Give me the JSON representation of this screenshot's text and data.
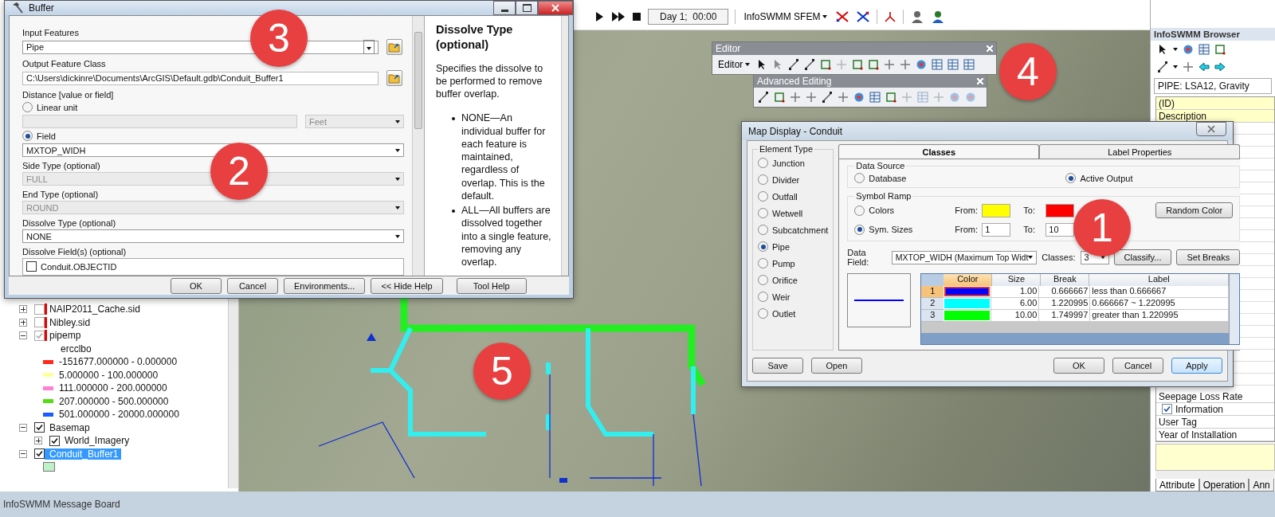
{
  "top_toolbar": {
    "time": "Day 1;  00:00",
    "menu": "InfoSWMM SFEM"
  },
  "editor_toolbar": {
    "title": "Editor",
    "menu": "Editor"
  },
  "advanced_editing_toolbar": {
    "title": "Advanced Editing"
  },
  "buffer_dialog": {
    "title": "Buffer",
    "fields": [
      {
        "kind": "input",
        "label": "Input Features",
        "value": "Pipe"
      },
      {
        "kind": "path",
        "label": "Output Feature Class",
        "value": "C:\\Users\\dickinre\\Documents\\ArcGIS\\Default.gdb\\Conduit_Buffer1"
      },
      {
        "kind": "heading",
        "label": "Distance [value or field]"
      },
      {
        "kind": "radio",
        "label": "Linear unit",
        "selected": false
      },
      {
        "kind": "unit",
        "unit": "Feet",
        "disabled": true
      },
      {
        "kind": "radio",
        "label": "Field",
        "selected": true
      },
      {
        "kind": "dropdown",
        "value": "MXTOP_WIDH",
        "disabled": false
      },
      {
        "kind": "dropdown",
        "label": "Side Type (optional)",
        "value": "FULL",
        "disabled": true
      },
      {
        "kind": "dropdown",
        "label": "End Type (optional)",
        "value": "ROUND",
        "disabled": true
      },
      {
        "kind": "dropdown",
        "label": "Dissolve Type (optional)",
        "value": "NONE",
        "disabled": false
      },
      {
        "kind": "checklist",
        "label": "Dissolve Field(s) (optional)",
        "items": [
          {
            "label": "Conduit.OBJECTID",
            "checked": false
          }
        ]
      }
    ],
    "buttons": [
      "OK",
      "Cancel",
      "Environments...",
      "<< Hide Help",
      "Tool Help"
    ],
    "help": {
      "title": "Dissolve Type (optional)",
      "intro": "Specifies the dissolve to be performed to remove buffer overlap.",
      "bullets": [
        "NONE—An individual buffer for each feature is maintained, regardless of overlap. This is the default.",
        "ALL—All buffers are dissolved together into a single feature, removing any overlap."
      ]
    }
  },
  "table_of_contents": {
    "layers": [
      {
        "name": "NAIP2011_Cache.sid",
        "expanded": false,
        "checked": false,
        "warning": true,
        "selected": false
      },
      {
        "name": "Nibley.sid",
        "expanded": false,
        "checked": false,
        "warning": true,
        "selected": false
      },
      {
        "name": "pipemp",
        "expanded": true,
        "checked": true,
        "warning": true,
        "selected": false,
        "legend": {
          "field": "ercclbo",
          "classes": [
            {
              "label": "-151677.000000 - 0.000000",
              "color": "#ff2a1a"
            },
            {
              "label": "5.000000 - 100.000000",
              "color": "#ffff99"
            },
            {
              "label": "111.000000 - 200.000000",
              "color": "#ff7fd0"
            },
            {
              "label": "207.000000 - 500.000000",
              "color": "#55dd11"
            },
            {
              "label": "501.000000 - 20000.000000",
              "color": "#1a5cff"
            }
          ]
        }
      },
      {
        "name": "Basemap",
        "expanded": true,
        "checked": true,
        "warning": false,
        "selected": false,
        "children": [
          {
            "name": "World_Imagery",
            "expanded": false,
            "checked": true,
            "warning": false,
            "selected": false
          }
        ]
      },
      {
        "name": "Conduit_Buffer1",
        "expanded": true,
        "checked": true,
        "warning": false,
        "selected": true,
        "legend": {
          "classes": [
            {
              "color": "#bff0c8"
            }
          ]
        }
      }
    ]
  },
  "map_display_dialog": {
    "title": "Map Display - Conduit",
    "element_type": {
      "label": "Element Type",
      "options": [
        {
          "label": "Junction",
          "selected": false
        },
        {
          "label": "Divider",
          "selected": false
        },
        {
          "label": "Outfall",
          "selected": false
        },
        {
          "label": "Wetwell",
          "selected": false
        },
        {
          "label": "Subcatchment",
          "selected": false
        },
        {
          "label": "Pipe",
          "selected": true
        },
        {
          "label": "Pump",
          "selected": false
        },
        {
          "label": "Orifice",
          "selected": false
        },
        {
          "label": "Weir",
          "selected": false
        },
        {
          "label": "Outlet",
          "selected": false
        }
      ]
    },
    "tabs": [
      {
        "label": "Classes",
        "selected": true
      },
      {
        "label": "Label Properties",
        "selected": false
      }
    ],
    "data_source": {
      "label": "Data Source",
      "options": [
        {
          "label": "Database",
          "selected": false
        },
        {
          "label": "Active Output",
          "selected": true
        }
      ]
    },
    "symbol_ramp": {
      "label": "Symbol Ramp",
      "rows": [
        {
          "kind": "color",
          "label": "Colors",
          "selected": false,
          "from_label": "From:",
          "from": {
            "color": "#ffff00"
          },
          "to_label": "To:",
          "to": {
            "color": "#ff0000"
          }
        },
        {
          "kind": "size",
          "label": "Sym. Sizes",
          "selected": true,
          "from_label": "From:",
          "from": {
            "value": "1"
          },
          "to_label": "To:",
          "to": {
            "value": "10"
          }
        }
      ]
    },
    "random_color_button": "Random Color",
    "data_field": {
      "label": "Data Field:",
      "value": "MXTOP_WIDH (Maximum Top Widt"
    },
    "classes": {
      "label": "Classes:",
      "value": "3"
    },
    "classify_button": "Classify...",
    "set_breaks_button": "Set Breaks",
    "table": {
      "columns": [
        "Color",
        "Size",
        "Break",
        "Label"
      ],
      "rows": [
        {
          "index": "1",
          "color": "#0000ff",
          "size": "1.00",
          "break": "0.666667",
          "label": "less than 0.666667",
          "selected": true
        },
        {
          "index": "2",
          "color": "#00ffff",
          "size": "6.00",
          "break": "1.220995",
          "label": "0.666667 ~ 1.220995",
          "selected": false
        },
        {
          "index": "3",
          "color": "#00ff00",
          "size": "10.00",
          "break": "1.749997",
          "label": "greater than 1.220995",
          "selected": false
        }
      ]
    },
    "left_buttons": [
      "Save",
      "Open"
    ],
    "right_buttons": [
      "OK",
      "Cancel",
      "Apply"
    ]
  },
  "browser_panel": {
    "title": "InfoSWMM Browser",
    "object": "PIPE: LSA12, Gravity",
    "property_sections": [
      {
        "rows": [
          {
            "kind": "text",
            "label": "(ID)",
            "highlight": true
          },
          {
            "kind": "text",
            "label": "Description",
            "highlight": true
          }
        ]
      },
      {
        "rows": [
          {
            "kind": "text",
            "label": "Seepage Loss Rate",
            "highlight": false
          },
          {
            "kind": "check",
            "label": "Information",
            "checked": true
          },
          {
            "kind": "text",
            "label": "User Tag",
            "highlight": false
          },
          {
            "kind": "text",
            "label": "Year of Installation",
            "highlight": false
          }
        ]
      }
    ],
    "tabs": [
      {
        "label": "Attribute",
        "selected": true
      },
      {
        "label": "Operation",
        "selected": false
      },
      {
        "label": "Ann",
        "selected": false
      }
    ]
  },
  "markers": [
    {
      "label": "3"
    },
    {
      "label": "4"
    },
    {
      "label": "2"
    },
    {
      "label": "1"
    },
    {
      "label": "5"
    }
  ],
  "status_bar": {
    "text": "InfoSWMM Message Board"
  }
}
